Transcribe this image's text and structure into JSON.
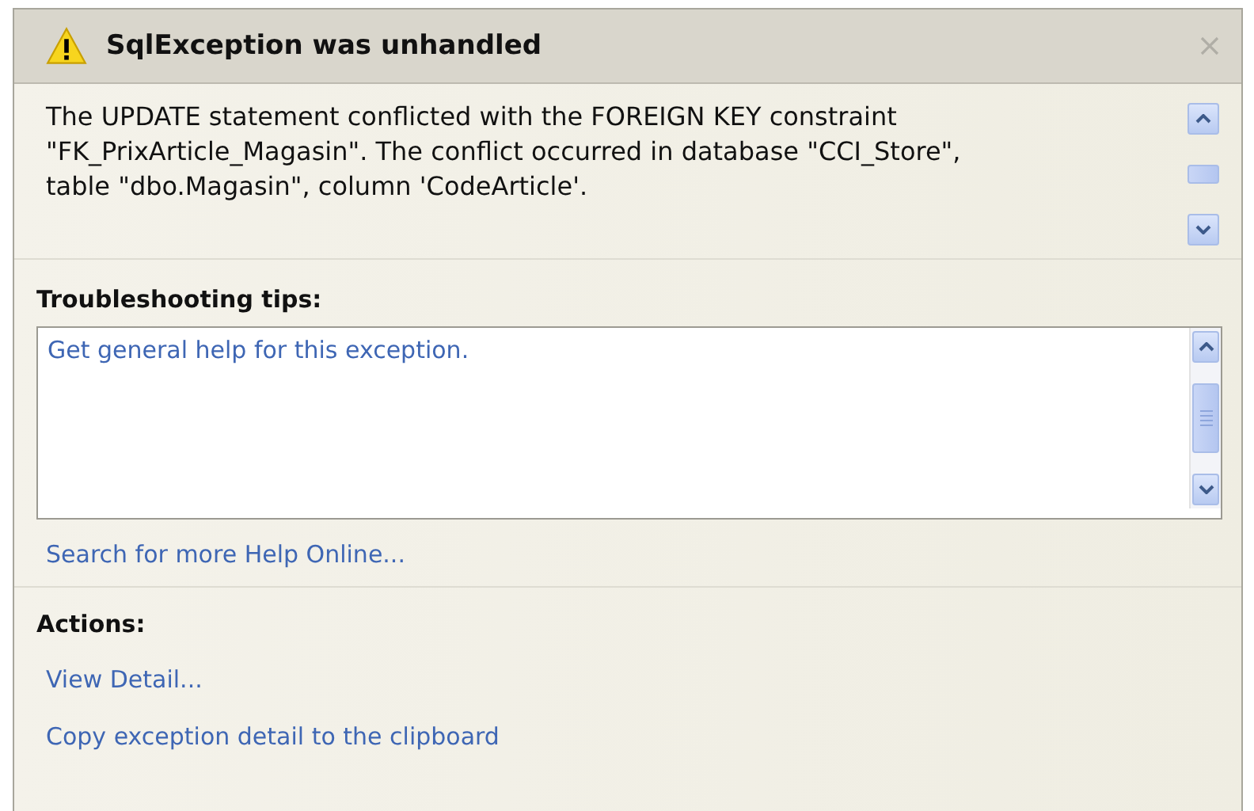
{
  "dialog": {
    "title": "SqlException was unhandled",
    "message": "The UPDATE statement conflicted with the FOREIGN KEY constraint \"FK_PrixArticle_Magasin\". The conflict occurred in database \"CCI_Store\", table \"dbo.Magasin\", column 'CodeArticle'."
  },
  "troubleshooting": {
    "heading": "Troubleshooting tips:",
    "tips": [
      "Get general help for this exception."
    ],
    "link": "Search for more Help Online..."
  },
  "actions": {
    "heading": "Actions:",
    "items": [
      "View Detail...",
      "Copy exception detail to the clipboard"
    ]
  }
}
